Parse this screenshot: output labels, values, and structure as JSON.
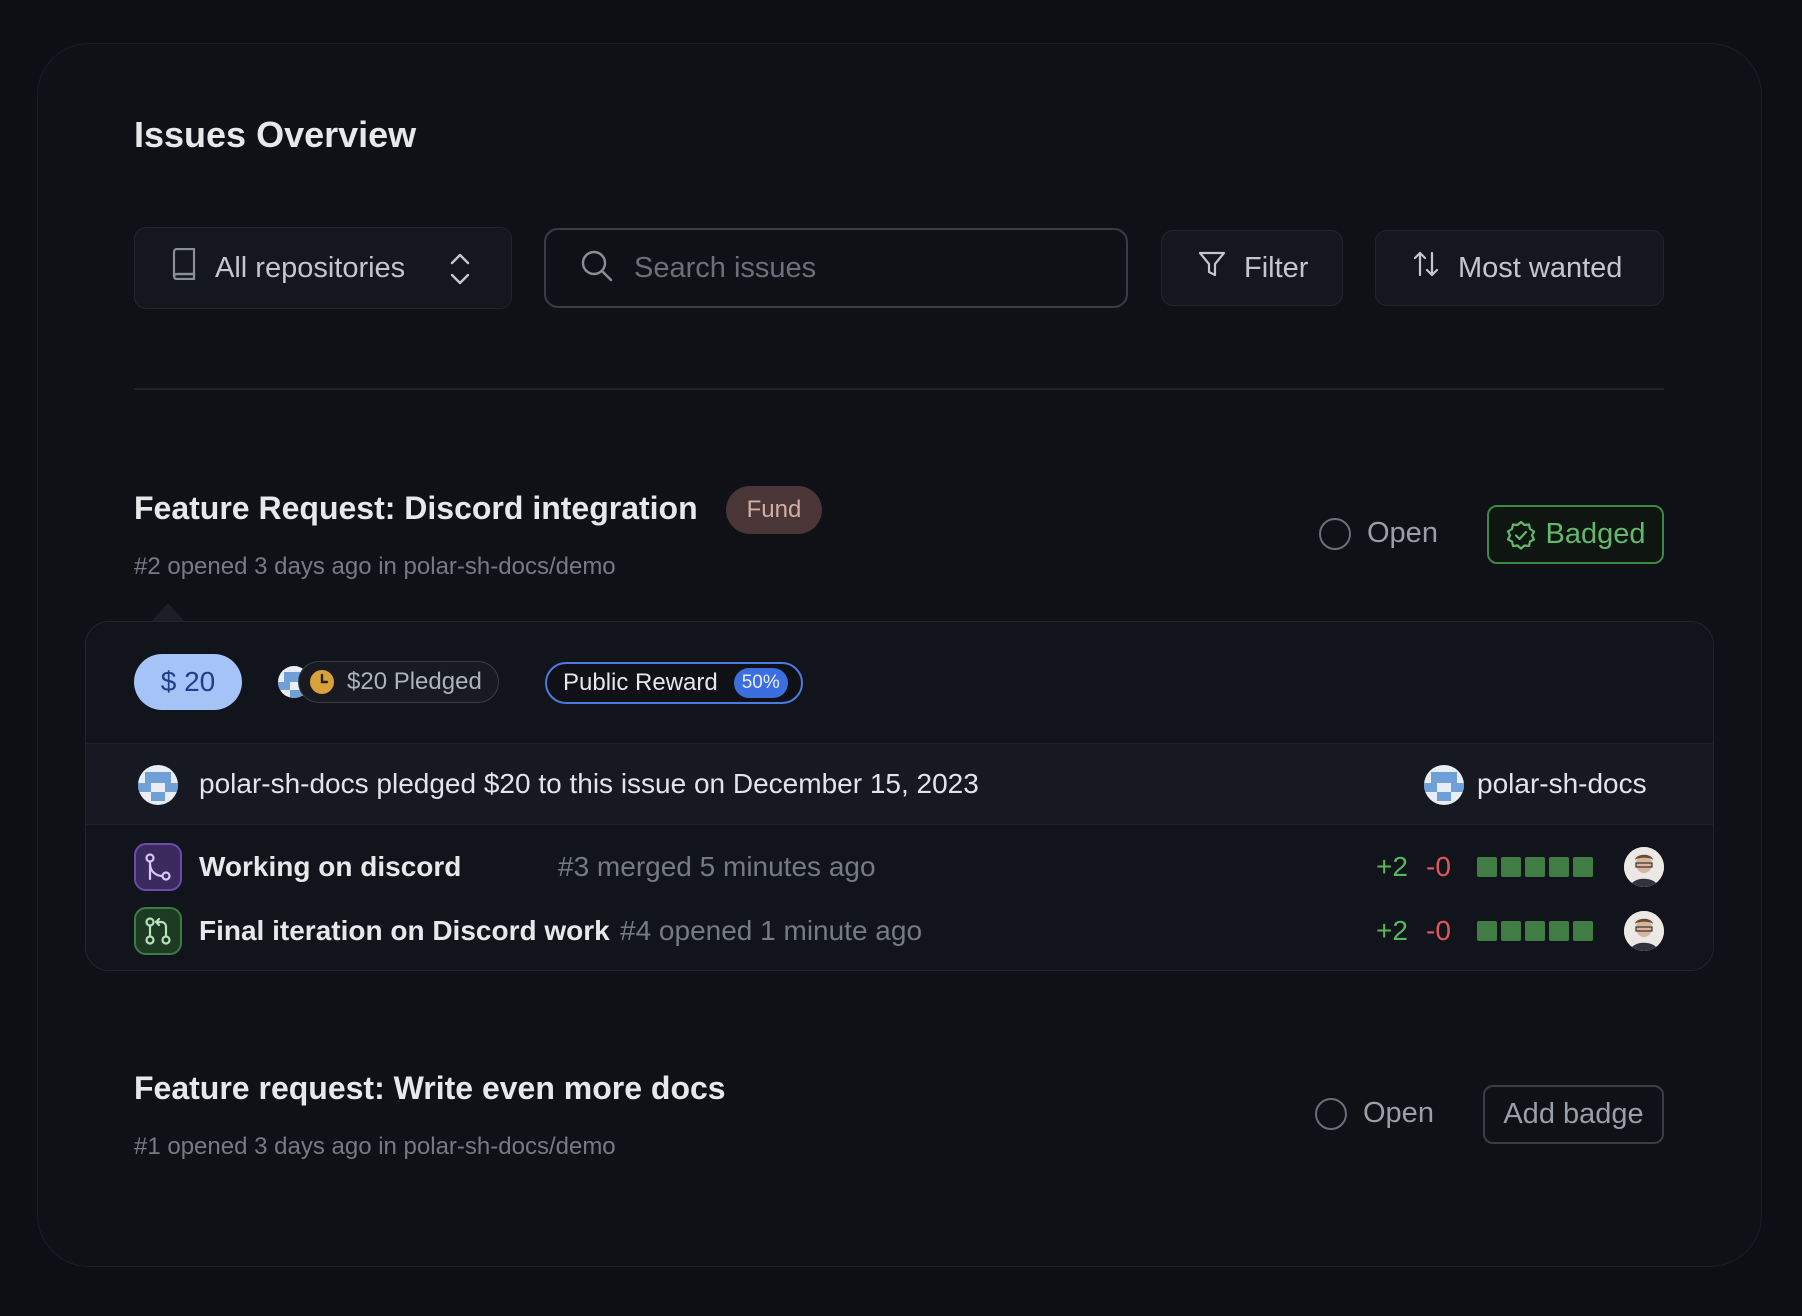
{
  "page": {
    "title": "Issues Overview"
  },
  "toolbar": {
    "repo_select": "All repositories",
    "search_placeholder": "Search issues",
    "filter_label": "Filter",
    "sort_label": "Most wanted"
  },
  "issues": [
    {
      "title": "Feature Request: Discord integration",
      "badge": "Fund",
      "meta": "#2 opened 3 days ago in polar-sh-docs/demo",
      "status": "Open",
      "action": "Badged",
      "funding": {
        "amount": "$ 20",
        "pledged": "$20 Pledged",
        "reward_label": "Public Reward",
        "reward_pct": "50%",
        "pledge_text": "polar-sh-docs pledged $20 to this issue on December 15, 2023",
        "pledger": "polar-sh-docs"
      },
      "pull_requests": [
        {
          "title": "Working on discord",
          "meta": "#3 merged 5 minutes ago",
          "additions": "+2",
          "deletions": "-0",
          "state": "merged"
        },
        {
          "title": "Final iteration on Discord work",
          "meta": "#4 opened 1 minute ago",
          "additions": "+2",
          "deletions": "-0",
          "state": "open"
        }
      ]
    },
    {
      "title": "Feature request: Write even more docs",
      "meta": "#1 opened 3 days ago in polar-sh-docs/demo",
      "status": "Open",
      "action": "Add badge"
    }
  ],
  "colors": {
    "accent_blue": "#a6c3f7",
    "badged_green": "#62b86b",
    "additions": "#57b75f",
    "deletions": "#e0575b",
    "fund_badge": "#4a3636"
  },
  "icons": {
    "repo": "book-icon",
    "select": "chevron-up-down-icon",
    "search": "search-icon",
    "filter": "funnel-icon",
    "sort": "arrows-up-down-icon",
    "badged": "check-badge-icon",
    "clock": "clock-icon"
  }
}
